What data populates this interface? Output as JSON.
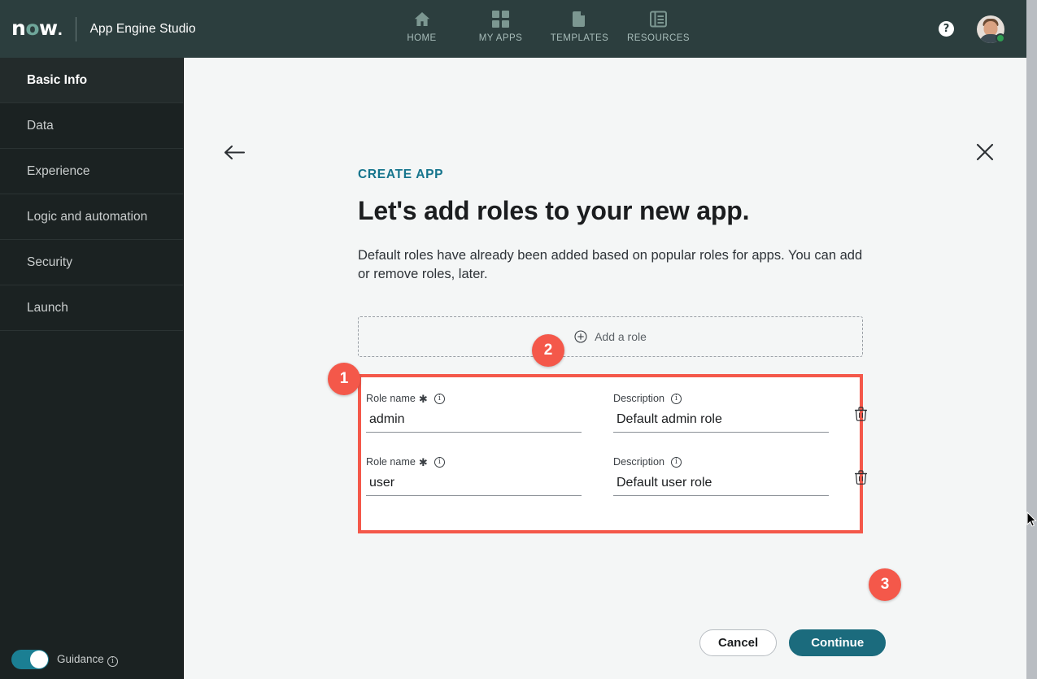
{
  "header": {
    "logo": "now",
    "logo_icon": "now-logo",
    "product_title": "App Engine Studio",
    "nav": [
      {
        "label": "HOME",
        "icon": "home-icon"
      },
      {
        "label": "MY APPS",
        "icon": "grid-apps-icon"
      },
      {
        "label": "TEMPLATES",
        "icon": "templates-copy-icon"
      },
      {
        "label": "RESOURCES",
        "icon": "resources-book-icon"
      }
    ],
    "help_label": "?",
    "help_icon": "help-question-icon",
    "avatar_icon": "user-avatar",
    "status": "online"
  },
  "sidebar": {
    "items": [
      {
        "label": "Basic Info",
        "active": true
      },
      {
        "label": "Data",
        "active": false
      },
      {
        "label": "Experience",
        "active": false
      },
      {
        "label": "Logic and automation",
        "active": false
      },
      {
        "label": "Security",
        "active": false
      },
      {
        "label": "Launch",
        "active": false
      }
    ],
    "guidance": {
      "label": "Guidance",
      "enabled": true,
      "info_icon": "info-icon"
    }
  },
  "main": {
    "back_icon": "back-arrow-icon",
    "close_icon": "close-icon",
    "eyebrow": "CREATE APP",
    "headline": "Let's add roles to your new app.",
    "subtext": "Default roles have already been added based on popular roles for apps. You can add or remove roles, later.",
    "add_role": {
      "label": "Add a role",
      "icon": "plus-circle-icon"
    },
    "roles": {
      "role_name_label": "Role name",
      "required_mark": "✱",
      "description_label": "Description",
      "info_icon": "info-icon",
      "delete_icon": "trash-icon",
      "rows": [
        {
          "role_name": "admin",
          "description": "Default admin role"
        },
        {
          "role_name": "user",
          "description": "Default user role"
        }
      ]
    },
    "actions": {
      "cancel_label": "Cancel",
      "continue_label": "Continue"
    }
  },
  "annotations": {
    "badges": [
      {
        "number": "1"
      },
      {
        "number": "2"
      },
      {
        "number": "3"
      }
    ],
    "highlight_color": "#f4584a"
  },
  "colors": {
    "header_bg": "#2c3e3e",
    "sidebar_bg": "#1b2222",
    "content_bg": "#f4f6f6",
    "accent_teal": "#16758d",
    "primary_button": "#1b6b7d",
    "annotation_red": "#f4584a",
    "status_green": "#2f9e52"
  }
}
